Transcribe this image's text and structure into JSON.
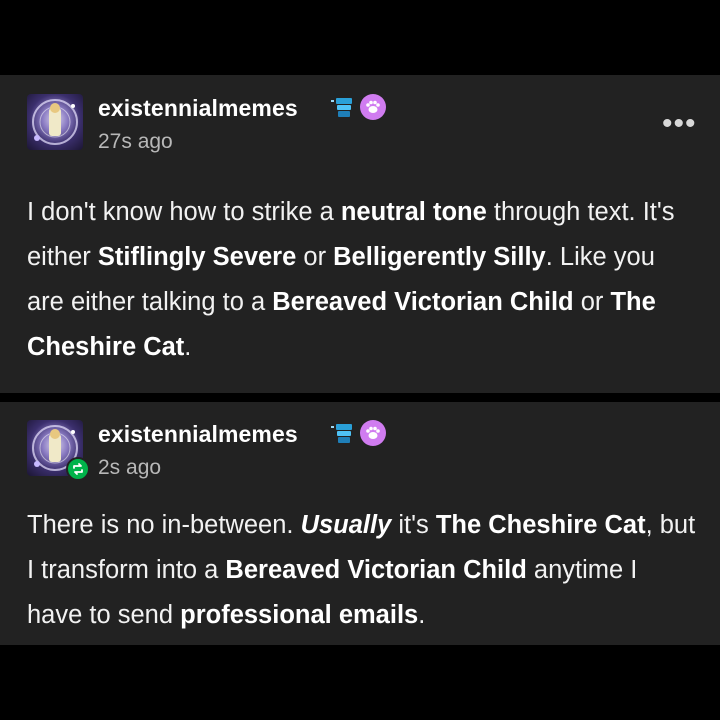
{
  "posts": [
    {
      "username": "existennialmemes",
      "timestamp": "27s ago",
      "body": [
        {
          "t": "I don't know how to strike a ",
          "s": "n"
        },
        {
          "t": "neutral tone",
          "s": "b"
        },
        {
          "t": " through text. It's either ",
          "s": "n"
        },
        {
          "t": "Stiflingly Severe",
          "s": "b"
        },
        {
          "t": " or ",
          "s": "n"
        },
        {
          "t": "Belligerently Silly",
          "s": "b"
        },
        {
          "t": ". Like you are either talking to a ",
          "s": "n"
        },
        {
          "t": "Bereaved Victorian Child",
          "s": "b"
        },
        {
          "t": " or ",
          "s": "n"
        },
        {
          "t": "The Cheshire Cat",
          "s": "b"
        },
        {
          "t": ".",
          "s": "n"
        }
      ]
    },
    {
      "username": "existennialmemes",
      "timestamp": "2s ago",
      "body": [
        {
          "t": "There is no in-between. ",
          "s": "n"
        },
        {
          "t": "Usually",
          "s": "i"
        },
        {
          "t": " it's ",
          "s": "n"
        },
        {
          "t": "The Cheshire Cat",
          "s": "b"
        },
        {
          "t": ", but I transform into a ",
          "s": "n"
        },
        {
          "t": "Bereaved Victorian Child",
          "s": "b"
        },
        {
          "t": " anytime I have to send ",
          "s": "n"
        },
        {
          "t": "professional emails",
          "s": "b"
        },
        {
          "t": ".",
          "s": "n"
        }
      ]
    }
  ],
  "icons": {
    "more": "more-options-icon",
    "bot_badge": "robot-badge-icon",
    "paw_badge": "paw-badge-icon",
    "reblog": "reblog-icon"
  },
  "colors": {
    "post_bg": "#222222",
    "page_bg": "#000000",
    "reblog_green": "#00b34a",
    "paw_pink": "#d07cf0"
  },
  "more_glyph": "•••"
}
